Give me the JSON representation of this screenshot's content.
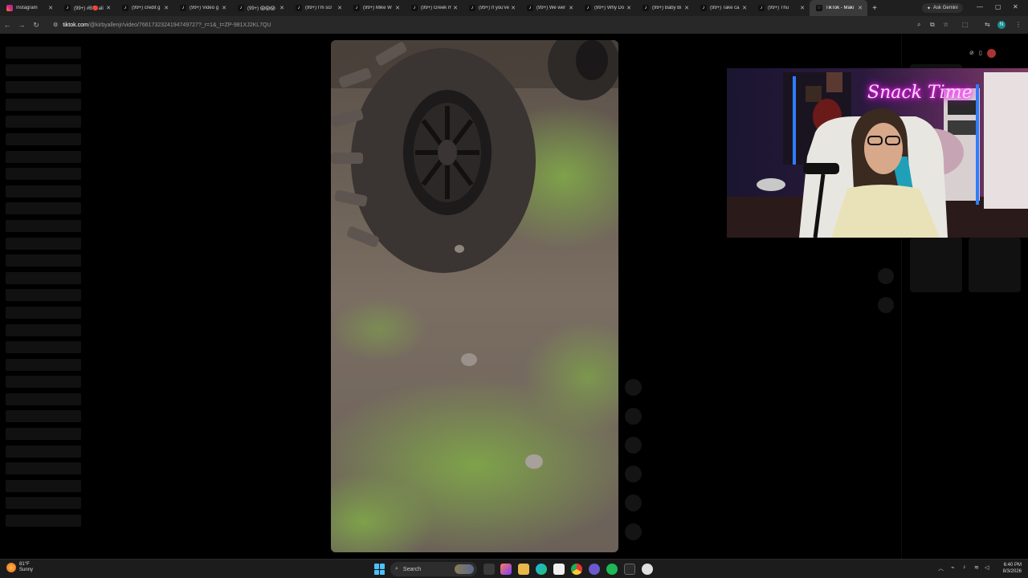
{
  "browser": {
    "tabs": [
      {
        "label": "Instagram",
        "icon": "instagram-icon"
      },
      {
        "label": "(99+) #B🔴ali",
        "icon": "tiktok-icon"
      },
      {
        "label": "(99+) credit g",
        "icon": "tiktok-icon"
      },
      {
        "label": "(99+) Video g",
        "icon": "tiktok-icon"
      },
      {
        "label": "(99+) 😱😱😱",
        "icon": "tiktok-icon"
      },
      {
        "label": "(99+) I'm scr",
        "icon": "tiktok-icon"
      },
      {
        "label": "(99+) Mike W",
        "icon": "tiktok-icon"
      },
      {
        "label": "(99+) Greek m",
        "icon": "tiktok-icon"
      },
      {
        "label": "(99+) If you've",
        "icon": "tiktok-icon"
      },
      {
        "label": "(99+) We wer",
        "icon": "tiktok-icon"
      },
      {
        "label": "(99+) Why Do",
        "icon": "tiktok-icon"
      },
      {
        "label": "(99+) Baby Bi",
        "icon": "tiktok-icon"
      },
      {
        "label": "(99+) Take ca",
        "icon": "tiktok-icon"
      },
      {
        "label": "(99+) Thu",
        "icon": "tiktok-icon"
      },
      {
        "label": "TikTok - Maki",
        "icon": "loading-icon",
        "active": true
      }
    ],
    "ask_gemini": "Ask Gemini",
    "address": {
      "host": "tiktok.com",
      "path": "/@kirbyallenjr/video/7661732324194749727?_r=1&_t=ZP-981XJ2KL7QU"
    },
    "profile_initial": "N"
  },
  "webcam": {
    "neon_sign": "Snack Time"
  },
  "taskbar": {
    "weather_temp": "81°F",
    "weather_desc": "Sunny",
    "search_label": "Search",
    "time": "6:40 PM",
    "date": "8/3/2026"
  },
  "colors": {
    "background": "#000000",
    "tab_strip": "#1f1f1f",
    "address_bar": "#282828",
    "taskbar": "#1c1c1c",
    "neon_pink": "#ff3cff"
  }
}
